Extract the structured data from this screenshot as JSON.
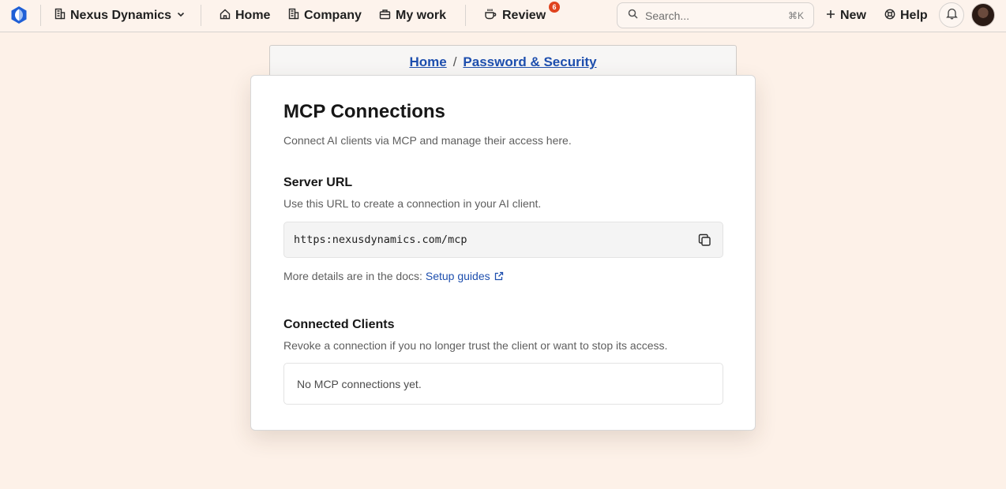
{
  "topbar": {
    "org_name": "Nexus Dynamics",
    "nav": {
      "home": "Home",
      "company": "Company",
      "my_work": "My work",
      "review": "Review",
      "review_badge": "6"
    },
    "search": {
      "placeholder": "Search...",
      "shortcut": "⌘K"
    },
    "new_label": "New",
    "help_label": "Help"
  },
  "breadcrumb": {
    "home": "Home",
    "separator": "/",
    "current": "Password & Security"
  },
  "main": {
    "title": "MCP Connections",
    "subtitle": "Connect AI clients via MCP and manage their access here.",
    "server_url": {
      "heading": "Server URL",
      "description": "Use this URL to create a connection in your AI client.",
      "value": "https:nexusdynamics.com/mcp",
      "docs_prefix": "More details are in the docs:",
      "docs_link": "Setup guides"
    },
    "clients": {
      "heading": "Connected Clients",
      "description": "Revoke a connection if you no longer trust the client or want to stop its access.",
      "empty": "No MCP connections yet."
    }
  },
  "colors": {
    "page_bg": "#fdf1e8",
    "link": "#1e4fae",
    "badge": "#e0431f",
    "logo_blue": "#1f5fd6"
  },
  "icons": [
    "app-logo-icon",
    "building-icon",
    "chevron-down-icon",
    "home-icon",
    "company-icon",
    "briefcase-icon",
    "coffee-icon",
    "search-icon",
    "plus-icon",
    "help-icon",
    "bell-icon",
    "copy-icon",
    "external-link-icon"
  ]
}
